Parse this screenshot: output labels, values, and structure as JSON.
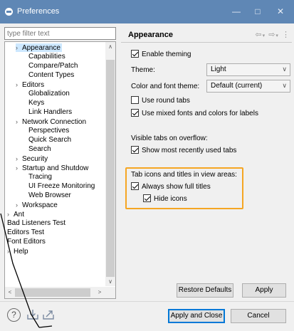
{
  "window": {
    "title": "Preferences"
  },
  "filter": {
    "placeholder": "type filter text"
  },
  "tree": {
    "items": [
      {
        "label": "Appearance"
      },
      {
        "label": "Capabilities"
      },
      {
        "label": "Compare/Patch"
      },
      {
        "label": "Content Types"
      },
      {
        "label": "Editors"
      },
      {
        "label": "Globalization"
      },
      {
        "label": "Keys"
      },
      {
        "label": "Link Handlers"
      },
      {
        "label": "Network Connection"
      },
      {
        "label": "Perspectives"
      },
      {
        "label": "Quick Search"
      },
      {
        "label": "Search"
      },
      {
        "label": "Security"
      },
      {
        "label": "Startup and Shutdow"
      },
      {
        "label": "Tracing"
      },
      {
        "label": "UI Freeze Monitoring"
      },
      {
        "label": "Web Browser"
      },
      {
        "label": "Workspace"
      },
      {
        "label": "Ant"
      },
      {
        "label": "Bad Listeners Test"
      },
      {
        "label": "Editors Test"
      },
      {
        "label": "Font Editors"
      },
      {
        "label": "Help"
      }
    ]
  },
  "page": {
    "title": "Appearance",
    "enable_theming": {
      "label": "Enable theming",
      "checked": true
    },
    "theme": {
      "label": "Theme:",
      "value": "Light"
    },
    "color_font_theme": {
      "label": "Color and font theme:",
      "value": "Default (current)"
    },
    "round_tabs": {
      "label": "Use round tabs",
      "checked": false
    },
    "mixed_fonts": {
      "label": "Use mixed fonts and colors for labels",
      "checked": true
    },
    "visible_tabs_heading": "Visible tabs on overflow:",
    "show_mru_tabs": {
      "label": "Show most recently used tabs",
      "checked": true
    },
    "tab_icons_heading": "Tab icons and titles in view areas:",
    "always_full_titles": {
      "label": "Always show full titles",
      "checked": true
    },
    "hide_icons": {
      "label": "Hide icons",
      "checked": true
    },
    "restore_defaults": "Restore Defaults",
    "apply": "Apply"
  },
  "footer": {
    "apply_and_close": "Apply and Close",
    "cancel": "Cancel"
  },
  "colors": {
    "titlebar": "#5f87b5",
    "highlight_border": "#f5a623",
    "selection": "#cde8ff",
    "default_button_border": "#0078d7"
  },
  "icons": [
    "eclipse-icon",
    "minimize-icon",
    "maximize-icon",
    "close-icon",
    "back-icon",
    "forward-icon",
    "view-menu-icon",
    "help-icon",
    "import-icon",
    "export-icon"
  ]
}
